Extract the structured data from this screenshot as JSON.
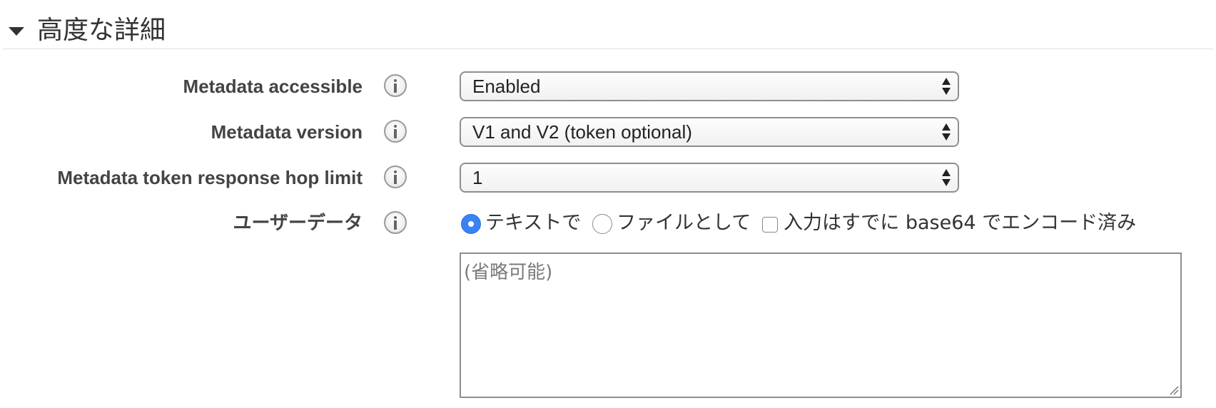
{
  "section": {
    "title": "高度な詳細"
  },
  "rows": [
    {
      "label": "Metadata accessible",
      "value": "Enabled"
    },
    {
      "label": "Metadata version",
      "value": "V1 and V2 (token optional)"
    },
    {
      "label": "Metadata token response hop limit",
      "value": "1"
    }
  ],
  "user_data": {
    "label": "ユーザーデータ",
    "option_text": "テキストで",
    "option_file": "ファイルとして",
    "checkbox_label": "入力はすでに base64 でエンコード済み",
    "selected": "text",
    "base64_checked": false,
    "placeholder": "(省略可能)"
  },
  "icons": {
    "info": "info-icon",
    "toggle": "caret-down-icon",
    "select_arrows": "up-down-arrows-icon",
    "resize": "resize-handle-icon"
  },
  "colors": {
    "radio_selected": "#3b82f6",
    "label_text": "#444444",
    "border": "#8e8e8e"
  }
}
